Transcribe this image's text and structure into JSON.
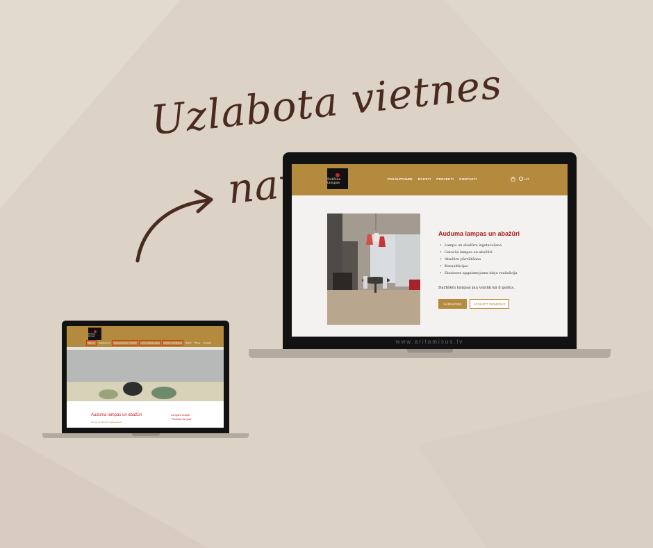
{
  "colors": {
    "background": "#dcd2c6",
    "headline": "#4a2a1e",
    "brand_gold": "#b48b3e",
    "brand_red": "#a8201f",
    "laptop_frame": "#121212"
  },
  "headline": "Uzlabota vietnes navigācija",
  "big_site": {
    "logo_text": "Rotētas lampas",
    "nav": [
      "PAKALPOJUMI",
      "RAKSTI",
      "PROJEKTI",
      "KONTAKTI"
    ],
    "cart_icon": "shopping-bag-icon",
    "lang_icon": "globe-icon",
    "lang_label": "LAT",
    "hero_title": "Auduma lampas un abažūri",
    "bullets": [
      "Lampu un abažūru izgatavošana",
      "Gatavās lampas un abažūri",
      "Abažūru pārvilkšana",
      "Konsultācijas",
      "Dizainera apgaismojuma ideju realizācija"
    ],
    "years_text": "Darbšēm lampas jau vairāk kā 8 gadus.",
    "primary_button": "SAZINĀTIES",
    "secondary_button": "APSKATĪT PIEMĒRUS",
    "watermark": "www.aritamisus.lv"
  },
  "small_site": {
    "logo_text": "Rotētas lampas",
    "nav": [
      "Sākums",
      "Pakalpojumi",
      "Gatavās lampas / abažūri",
      "Lampu izgatavošana",
      "Abažūru pārvilkšana",
      "Raksti",
      "Blogs",
      "Kontakti"
    ],
    "hero_title": "Auduma lampas un abažūri",
    "hero_sub": "Lampu un abažūru izgatavošana",
    "right_line1": "Lampas studija",
    "right_line2": "\"Rotētas lampas\""
  }
}
